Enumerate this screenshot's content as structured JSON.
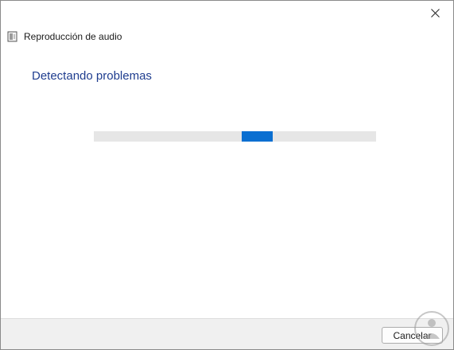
{
  "window": {
    "title": "Reproducción de audio",
    "close_icon": "close-icon",
    "app_icon": "audio-troubleshooter-icon"
  },
  "main": {
    "heading": "Detectando problemas",
    "progress": {
      "mode": "indeterminate",
      "position_fraction": 0.59,
      "color": "#0a6fd1",
      "track_color": "#e6e6e6"
    }
  },
  "footer": {
    "cancel_label": "Cancelar"
  },
  "colors": {
    "heading": "#1f3d8f",
    "accent": "#0a6fd1"
  }
}
